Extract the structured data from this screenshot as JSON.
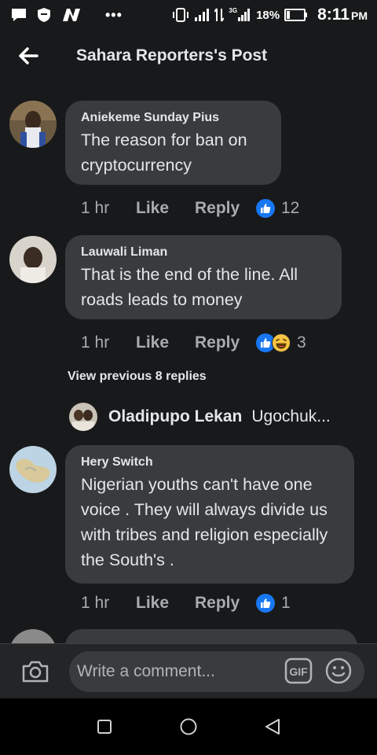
{
  "status_bar": {
    "battery_percent": "18%",
    "time": "8:11",
    "ampm": "PM",
    "network": "3G",
    "icons": [
      "chat-bubble-icon",
      "shield-icon",
      "n-logo-icon",
      "more-dots-icon",
      "vibrate-icon",
      "signal-icon",
      "data-arrows-icon",
      "signal-3g-icon",
      "battery-icon"
    ]
  },
  "header": {
    "title": "Sahara Reporters's Post",
    "back_icon": "arrow-left-icon"
  },
  "comments": [
    {
      "author": "Aniekeme Sunday Pius",
      "text": "The reason for ban on cryptocurrency",
      "time": "1 hr",
      "like_label": "Like",
      "reply_label": "Reply",
      "reaction_count": "12",
      "reactions": [
        "like"
      ]
    },
    {
      "author": "Lauwali Liman",
      "text": "That is the end of the line. All roads leads to money",
      "time": "1 hr",
      "like_label": "Like",
      "reply_label": "Reply",
      "reaction_count": "3",
      "reactions": [
        "like",
        "haha"
      ]
    },
    {
      "author": "Hery Switch",
      "text": "Nigerian youths can't have one voice . They will always divide us with tribes and religion especially the South's .",
      "time": "1 hr",
      "like_label": "Like",
      "reply_label": "Reply",
      "reaction_count": "1",
      "reactions": [
        "like"
      ]
    }
  ],
  "view_previous": "View previous 8 replies",
  "reply_preview": {
    "author": "Oladipupo Lekan",
    "text": "Ugochuk..."
  },
  "composer": {
    "placeholder": "Write a comment...",
    "camera_icon": "camera-icon",
    "gif_label": "GIF",
    "emoji_icon": "smiley-icon"
  },
  "nav": {
    "icons": [
      "recent-apps-icon",
      "home-icon",
      "back-triangle-icon"
    ]
  },
  "colors": {
    "background": "#18191a",
    "bubble": "#3a3b3c",
    "text": "#e4e6eb",
    "meta": "#a8abaf",
    "like_blue": "#1877f2"
  }
}
